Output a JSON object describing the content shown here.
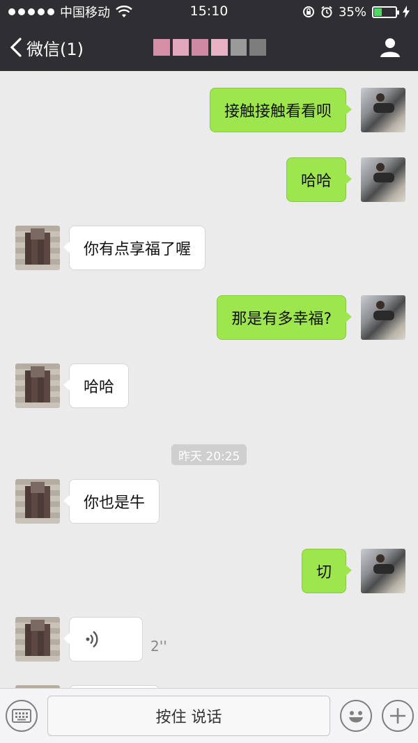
{
  "status": {
    "carrier": "中国移动",
    "time": "15:10",
    "battery_percent": "35%",
    "battery_level": 0.35,
    "accent": "#4cd964"
  },
  "nav": {
    "back_label": "微信(1)",
    "contact_icon": "person-icon"
  },
  "messages": [
    {
      "side": "me",
      "text": "接触接触看看呗"
    },
    {
      "side": "me",
      "text": "哈哈"
    },
    {
      "side": "other",
      "text": "你有点享福了喔"
    },
    {
      "side": "me",
      "text": "那是有多幸福?"
    },
    {
      "side": "other",
      "text": "哈哈"
    },
    {
      "side": "other",
      "text": "你也是牛"
    },
    {
      "side": "me",
      "text": "切"
    },
    {
      "side": "other",
      "type": "voice",
      "duration": "2''"
    }
  ],
  "timestamp": "昨天 20:25",
  "inputbar": {
    "hold_to_talk": "按住 说话",
    "keyboard_icon": "keyboard-icon",
    "emoji_icon": "emoji-icon",
    "add_icon": "plus-icon"
  },
  "colors": {
    "bubble_me": "#9de64d",
    "bubble_other": "#ffffff",
    "header": "#2f2f33",
    "background": "#ebebeb"
  }
}
